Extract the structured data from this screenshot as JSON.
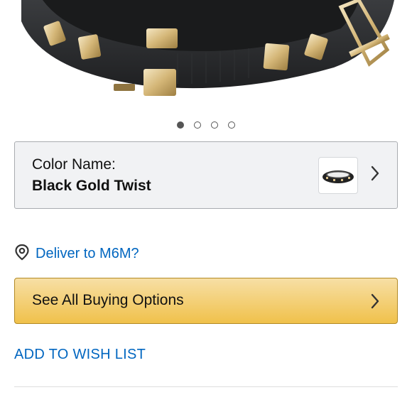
{
  "product": {
    "image_name": "wristband-product-image",
    "carousel": {
      "total": 4,
      "active_index": 0
    }
  },
  "color_selector": {
    "label": "Color Name:",
    "value": "Black Gold Twist"
  },
  "delivery": {
    "icon": "location-pin-icon",
    "text": "Deliver to M6M?"
  },
  "buying_options": {
    "label": "See All Buying Options"
  },
  "wishlist": {
    "label": "ADD TO WISH LIST"
  },
  "colors": {
    "link": "#0066c0",
    "button_yellow": "#f0c14b",
    "band_black": "#2a2c2e",
    "stud_gold": "#d9c08a"
  }
}
